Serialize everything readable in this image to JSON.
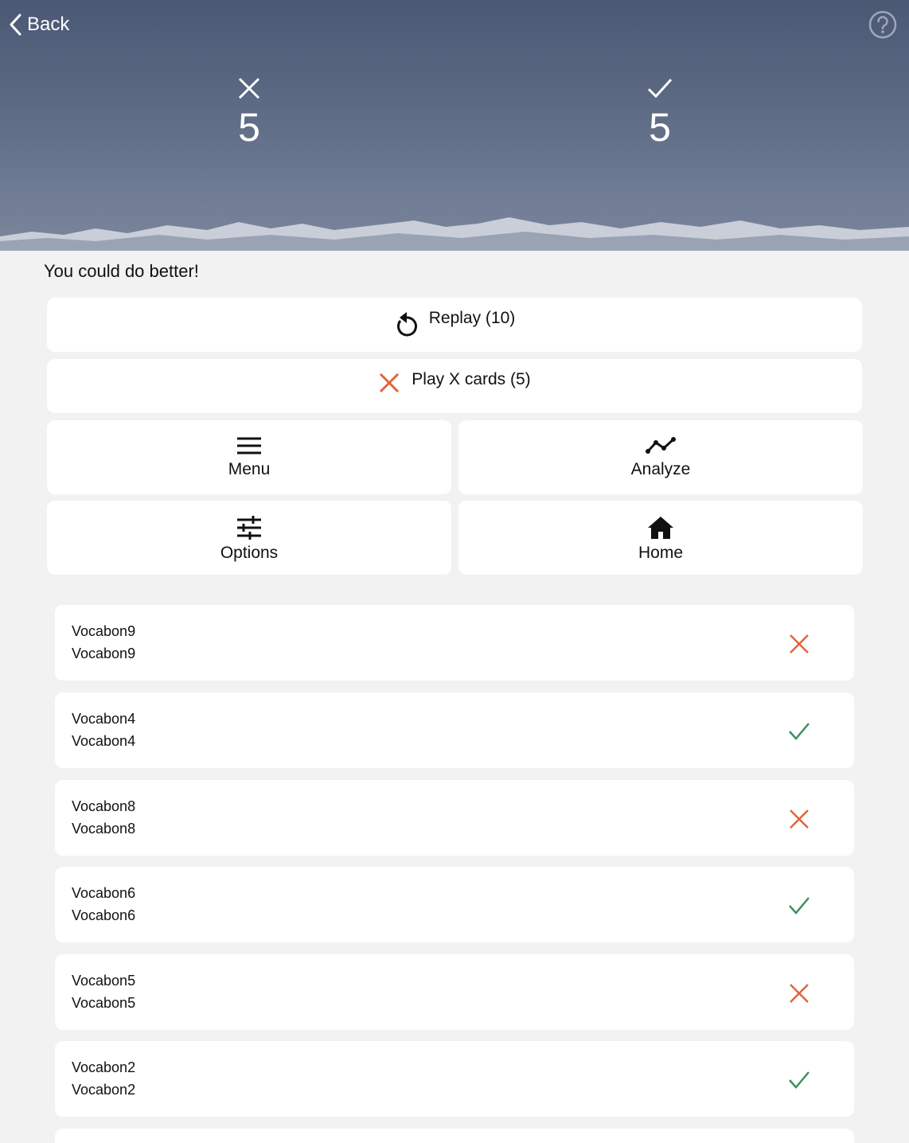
{
  "header": {
    "back_label": "Back",
    "wrong_count": "5",
    "right_count": "5",
    "icons": {
      "back": "chevron-left-icon",
      "help": "question-circle-icon",
      "wrong": "x-icon",
      "right": "check-icon"
    }
  },
  "feedback": "You could do better!",
  "actions": {
    "replay": {
      "label": "Replay (10)",
      "icon": "replay-icon"
    },
    "play_x": {
      "label": "Play X cards (5)",
      "icon": "x-icon"
    },
    "menu": {
      "label": "Menu",
      "icon": "hamburger-menu-icon"
    },
    "analyze": {
      "label": "Analyze",
      "icon": "line-chart-icon"
    },
    "options": {
      "label": "Options",
      "icon": "sliders-icon"
    },
    "home": {
      "label": "Home",
      "icon": "home-icon"
    }
  },
  "results": [
    {
      "front": "Vocabon9",
      "back": "Vocabon9",
      "status": "wrong"
    },
    {
      "front": "Vocabon4",
      "back": "Vocabon4",
      "status": "correct"
    },
    {
      "front": "Vocabon8",
      "back": "Vocabon8",
      "status": "wrong"
    },
    {
      "front": "Vocabon6",
      "back": "Vocabon6",
      "status": "correct"
    },
    {
      "front": "Vocabon5",
      "back": "Vocabon5",
      "status": "wrong"
    },
    {
      "front": "Vocabon2",
      "back": "Vocabon2",
      "status": "correct"
    }
  ],
  "colors": {
    "wrong": "#e0653a",
    "correct": "#3f8f5f",
    "background": "#f2f2f2",
    "header_top": "#4a5874"
  }
}
